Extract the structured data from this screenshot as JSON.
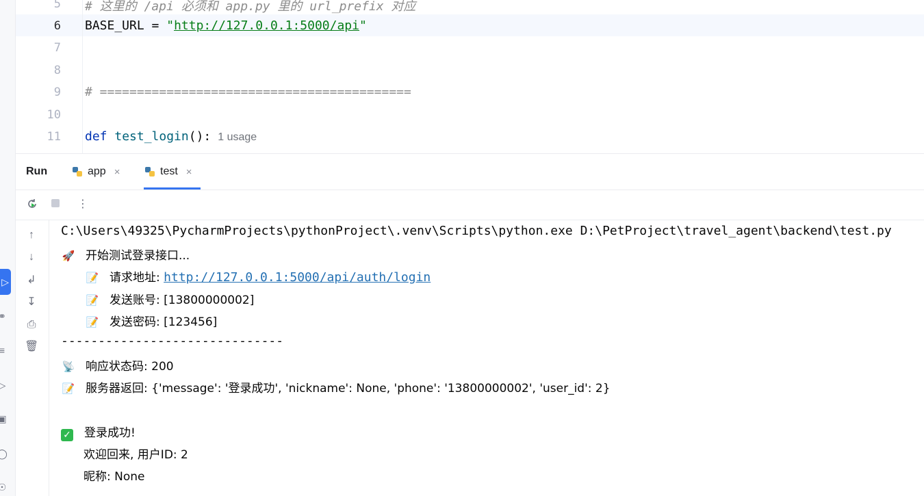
{
  "editor": {
    "lines": [
      {
        "num": "5",
        "text": "# 这里的 /api 必须和 app.py 里的 url_prefix 对应"
      },
      {
        "num": "6",
        "prefix": "BASE_URL = ",
        "url": "http://127.0.0.1:5000/api"
      },
      {
        "num": "7",
        "text": ""
      },
      {
        "num": "8",
        "text": ""
      },
      {
        "num": "9",
        "text": "# =========================================="
      },
      {
        "num": "10",
        "text": ""
      },
      {
        "num": "11",
        "kw": "def",
        "fn": "test_login",
        "rest": "():",
        "hint": "1 usage"
      }
    ]
  },
  "run": {
    "label": "Run",
    "tabs": [
      {
        "label": "app"
      },
      {
        "label": "test"
      }
    ],
    "close_glyph": "×"
  },
  "console": {
    "cmd": "C:\\Users\\49325\\PycharmProjects\\pythonProject\\.venv\\Scripts\\python.exe D:\\PetProject\\travel_agent\\backend\\test.py",
    "start": {
      "icon": "🚀",
      "text": "开始测试登录接口..."
    },
    "req_url": {
      "icon": "📝",
      "label": "请求地址: ",
      "url": "http://127.0.0.1:5000/api/auth/login"
    },
    "account": {
      "icon": "📝",
      "text": "发送账号: [13800000002]"
    },
    "password": {
      "icon": "📝",
      "text": "发送密码: [123456]"
    },
    "divider": "------------------------------",
    "status": {
      "icon": "📡",
      "text": "响应状态码: 200"
    },
    "response": {
      "icon": "📝",
      "text": "服务器返回: {'message': '登录成功', 'nickname': None, 'phone': '13800000002', 'user_id': 2}"
    },
    "success": {
      "icon": "✓",
      "text": "登录成功!"
    },
    "welcome": "欢迎回来, 用户ID: 2",
    "nickname": "昵称: None"
  },
  "colors": {
    "accent": "#3574f0",
    "string": "#067d17",
    "link": "#2470b3",
    "keyword": "#0033b3",
    "success": "#2fb84f"
  }
}
